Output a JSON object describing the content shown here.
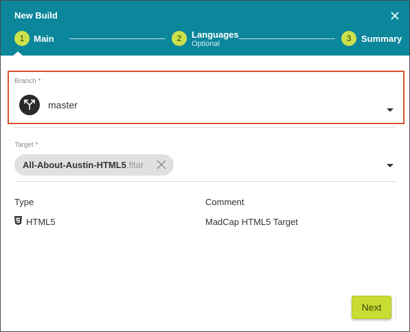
{
  "dialog": {
    "title": "New Build",
    "close_icon": "close-icon"
  },
  "steps": [
    {
      "number": "1",
      "label": "Main",
      "sublabel": "",
      "active": true
    },
    {
      "number": "2",
      "label": "Languages",
      "sublabel": "Optional",
      "active": false
    },
    {
      "number": "3",
      "label": "Summary",
      "sublabel": "",
      "active": false
    }
  ],
  "branch": {
    "label": "Branch *",
    "value": "master",
    "icon": "branch-icon"
  },
  "target": {
    "label": "Target *",
    "chip_name": "All-About-Austin-HTML5",
    "chip_ext": ".fltar"
  },
  "table": {
    "headers": {
      "type": "Type",
      "comment": "Comment"
    },
    "rows": [
      {
        "type": "HTML5",
        "comment": "MadCap HTML5 Target",
        "icon": "html5-icon"
      }
    ]
  },
  "footer": {
    "next_label": "Next"
  },
  "colors": {
    "header_bg": "#0b869b",
    "step_circle": "#cde14c",
    "focus_border": "#d9532c",
    "next_button": "#c9dc34"
  }
}
